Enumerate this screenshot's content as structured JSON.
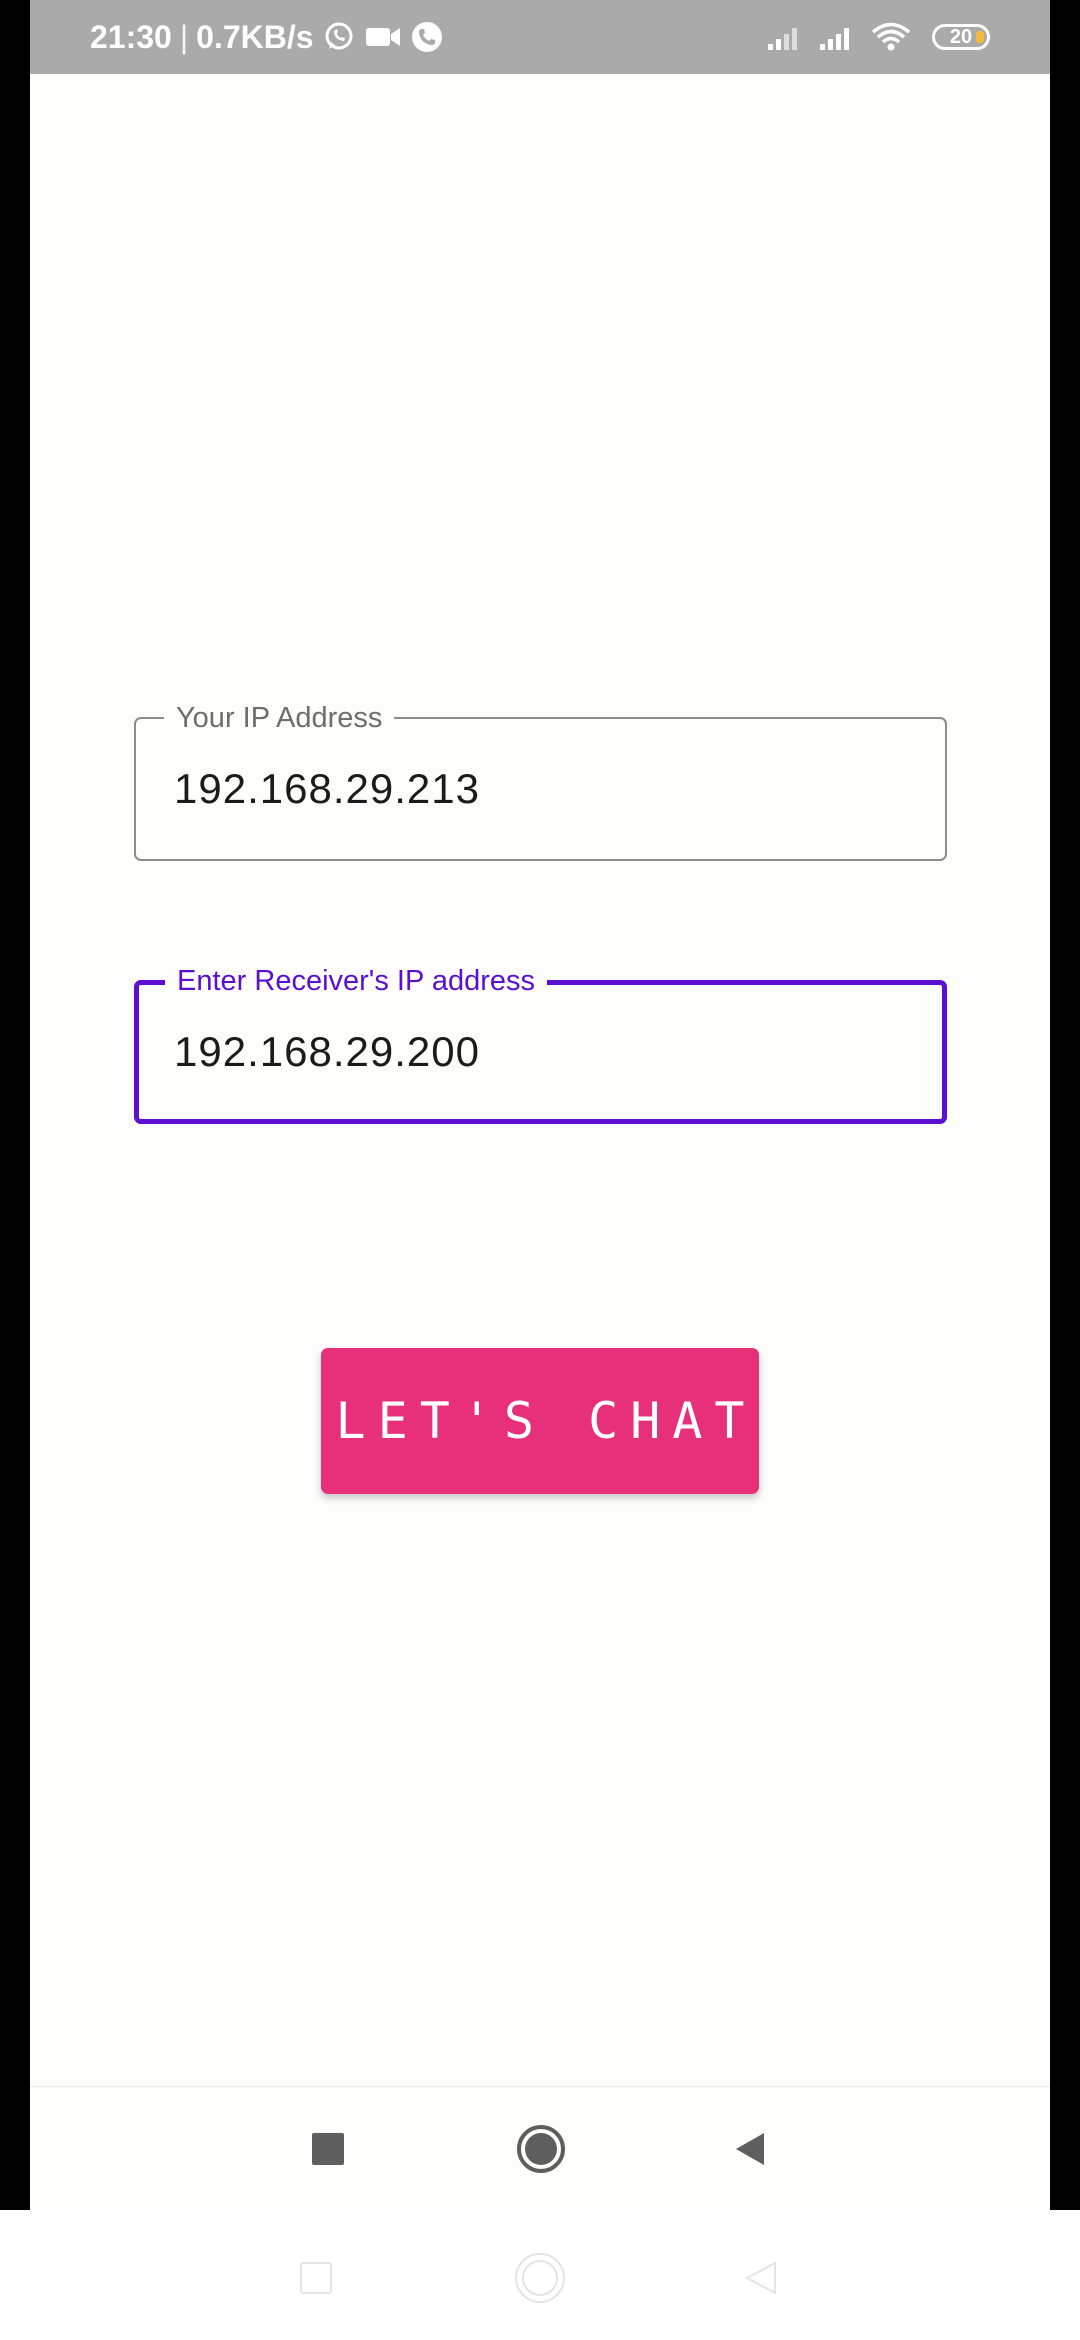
{
  "status_bar": {
    "time": "21:30",
    "network_speed": "0.7KB/s",
    "separator": "|",
    "left_icons": [
      "whatsapp-icon",
      "video-call-icon",
      "phone-call-icon"
    ],
    "right_icons": [
      "signal-icon",
      "signal-icon",
      "wifi-icon",
      "battery-icon"
    ],
    "battery_level": "20"
  },
  "form": {
    "your_ip": {
      "label": "Your IP Address",
      "value": "192.168.29.213",
      "state": "idle"
    },
    "receiver_ip": {
      "label": "Enter Receiver's IP address",
      "value": "192.168.29.200",
      "state": "focused"
    },
    "submit_label": "LET'S CHAT"
  },
  "nav_bar": {
    "buttons": [
      "recents-icon",
      "home-icon",
      "back-icon"
    ]
  },
  "colors": {
    "status_bar_bg": "#a9aaa9",
    "background": "#fdfdfc",
    "accent_focus": "#5a0fd2",
    "button_bg": "#e8307a",
    "idle_border": "#8c8c8c"
  }
}
